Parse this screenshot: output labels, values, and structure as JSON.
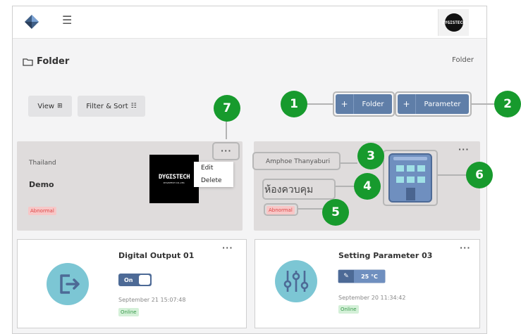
{
  "header": {
    "avatar_text": "DYGISTECH"
  },
  "page": {
    "title": "Folder",
    "breadcrumb": "Folder"
  },
  "toolbar": {
    "view_label": "View",
    "filter_label": "Filter & Sort",
    "add_folder_label": "Folder",
    "add_parameter_label": "Parameter",
    "plus": "+"
  },
  "folders": [
    {
      "location": "Thailand",
      "name": "Demo",
      "status": "Abnormal",
      "logo_text": "DYGISTECH",
      "logo_subtext": "DYGISTECH CO.,LTD."
    },
    {
      "location": "Amphoe Thanyaburi",
      "name": "ห้องควบคุม",
      "status": "Abnormal"
    }
  ],
  "context_menu": {
    "items": [
      "Edit",
      "Delete"
    ]
  },
  "devices": [
    {
      "name": "Digital Output 01",
      "toggle_label": "On",
      "timestamp": "September 21 15:07:48",
      "status": "Online"
    },
    {
      "name": "Setting Parameter 03",
      "value": "25 °C",
      "timestamp": "September 20 11:34:42",
      "status": "Online"
    }
  ],
  "callouts": [
    "1",
    "2",
    "3",
    "4",
    "5",
    "6",
    "7"
  ],
  "colors": {
    "accent": "#5f7ea8",
    "callout": "#179a2d",
    "icon_circle": "#7cc6d4",
    "abnormal": "#f7c7c7",
    "online": "#d4f0d8"
  }
}
